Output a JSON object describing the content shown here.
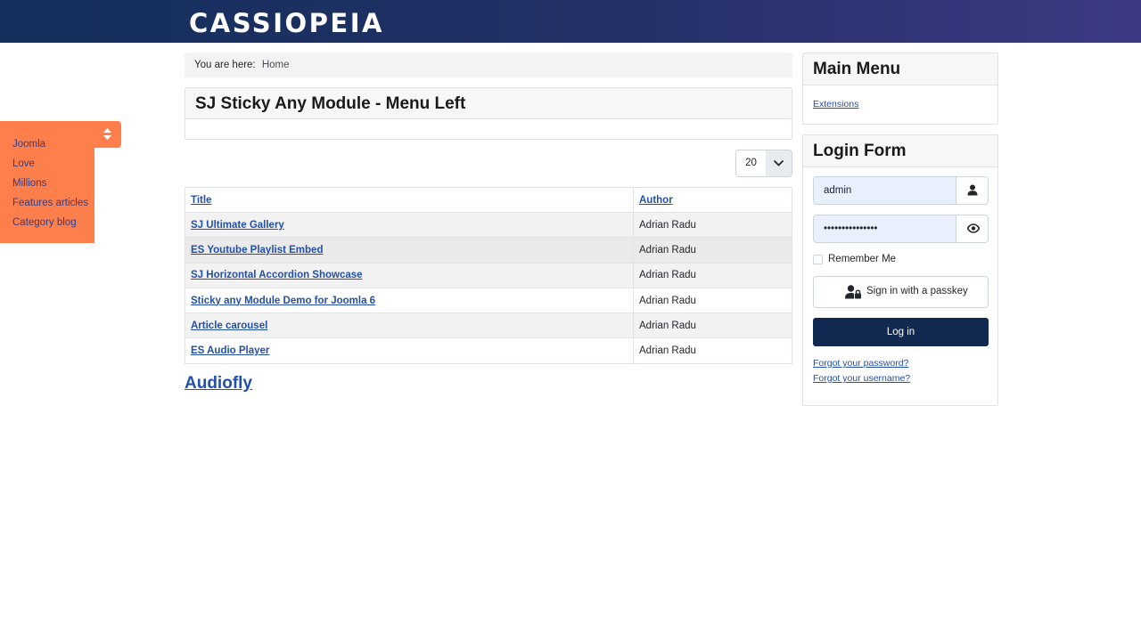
{
  "site": {
    "brand": "CASSIOPEIA"
  },
  "sticky_menu": {
    "items": [
      "Joomla",
      "Love",
      "Millions",
      "Features articles",
      "Category blog"
    ],
    "colors": {
      "background": "#ff7f4c",
      "link": "#2c3f8a"
    }
  },
  "breadcrumb": {
    "label": "You are here:",
    "home": "Home"
  },
  "module": {
    "title": "SJ Sticky Any Module - Menu Left"
  },
  "list": {
    "limit": "20",
    "columns": [
      "Title",
      "Author"
    ],
    "rows": [
      {
        "title": "SJ Ultimate Gallery",
        "author": "Adrian Radu"
      },
      {
        "title": "ES Youtube Playlist Embed",
        "author": "Adrian Radu"
      },
      {
        "title": "SJ Horizontal Accordion Showcase",
        "author": "Adrian Radu"
      },
      {
        "title": "Sticky any Module Demo for Joomla 6",
        "author": "Adrian Radu"
      },
      {
        "title": "Article carousel",
        "author": "Adrian Radu"
      },
      {
        "title": "ES Audio Player",
        "author": "Adrian Radu"
      }
    ]
  },
  "audiofly": "Audiofly",
  "main_menu": {
    "title": "Main Menu",
    "link": "Extensions"
  },
  "login_form": {
    "title": "Login Form",
    "username": "admin",
    "password": "•••••••••••••••",
    "remember": "Remember Me",
    "passkey": "Sign in with a passkey",
    "login": "Log in",
    "forgot_password": "Forgot your password?",
    "forgot_username": "Forgot your username?"
  },
  "colors": {
    "header_start": "#132f5b",
    "header_end": "#3c3a84",
    "primary_button": "#112850",
    "link": "#224faa"
  }
}
